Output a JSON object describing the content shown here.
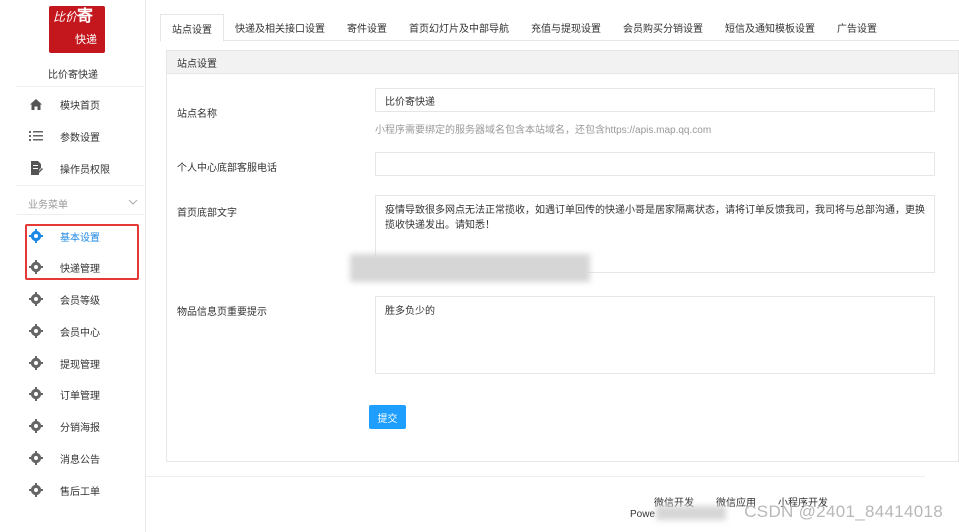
{
  "brand": {
    "logo_top": "比价",
    "logo_char": "寄",
    "logo_bottom": "快递",
    "shop_name": "比价寄快递",
    "logo_color": "#c4171d"
  },
  "sidebar": {
    "top_items": [
      {
        "label": "模块首页",
        "icon": "home-icon"
      },
      {
        "label": "参数设置",
        "icon": "list-icon"
      },
      {
        "label": "操作员权限",
        "icon": "document-edit-icon"
      }
    ],
    "section_title": "业务菜单",
    "biz_items": [
      {
        "label": "基本设置",
        "icon": "gear-icon",
        "active": true
      },
      {
        "label": "快递管理",
        "icon": "gear-icon"
      },
      {
        "label": "会员等级",
        "icon": "gear-icon"
      },
      {
        "label": "会员中心",
        "icon": "gear-icon"
      },
      {
        "label": "提现管理",
        "icon": "gear-icon"
      },
      {
        "label": "订单管理",
        "icon": "gear-icon"
      },
      {
        "label": "分销海报",
        "icon": "gear-icon"
      },
      {
        "label": "消息公告",
        "icon": "gear-icon"
      },
      {
        "label": "售后工单",
        "icon": "gear-icon"
      }
    ]
  },
  "tabs": [
    {
      "label": "站点设置",
      "active": true
    },
    {
      "label": "快递及相关接口设置"
    },
    {
      "label": "寄件设置"
    },
    {
      "label": "首页幻灯片及中部导航"
    },
    {
      "label": "充值与提现设置"
    },
    {
      "label": "会员购买分销设置"
    },
    {
      "label": "短信及通知模板设置"
    },
    {
      "label": "广告设置"
    }
  ],
  "panel": {
    "title": "站点设置",
    "site_name_label": "站点名称",
    "site_name_value": "比价寄快递",
    "site_name_help": "小程序需要绑定的服务器域名包含本站域名，还包含https://apis.map.qq.com",
    "phone_label": "个人中心底部客服电话",
    "phone_value": "",
    "footer_text_label": "首页底部文字",
    "footer_text_value": "疫情导致很多网点无法正常揽收，如遇订单回传的快递小哥是居家隔离状态，请将订单反馈我司，我司将与总部沟通，更换揽收快递发出。请知悉！",
    "important_label": "物品信息页重要提示",
    "important_value": "胜多负少的",
    "submit_label": "提交"
  },
  "footer": {
    "links": [
      "微信开发",
      "微信应用",
      "小程序开发"
    ],
    "powered": "Powe"
  },
  "watermark": "CSDN @2401_84414018",
  "colors": {
    "accent": "#1e9fff",
    "active_menu": "#1e88e5",
    "highlight": "#e53935"
  }
}
